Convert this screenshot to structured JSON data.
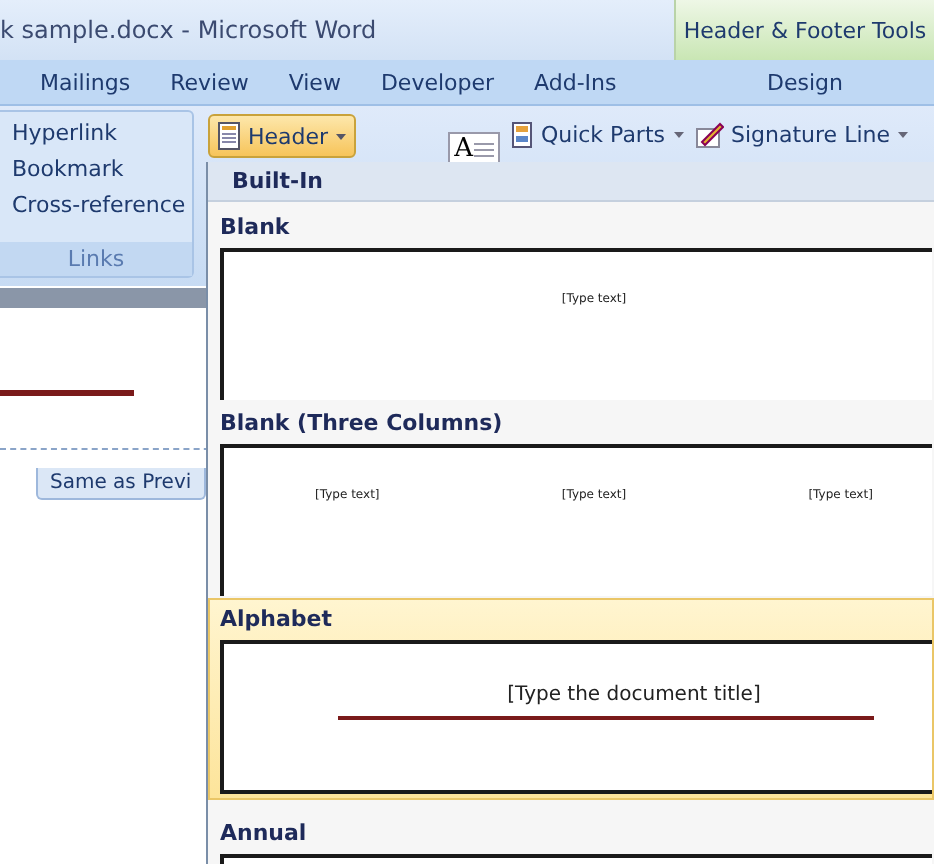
{
  "window": {
    "title": "k sample.docx - Microsoft Word",
    "contextual_title": "Header & Footer Tools"
  },
  "tabs": [
    {
      "label": "Mailings",
      "selected": false
    },
    {
      "label": "Review",
      "selected": false
    },
    {
      "label": "View",
      "selected": false
    },
    {
      "label": "Developer",
      "selected": false
    },
    {
      "label": "Add-Ins",
      "selected": false
    },
    {
      "label": "Design",
      "selected": false
    }
  ],
  "links_group": {
    "items": [
      "Hyperlink",
      "Bookmark",
      "Cross-reference"
    ],
    "label": "Links"
  },
  "insert_group": {
    "header_button": {
      "label": "Header",
      "active": true
    },
    "text_box_glyph": "A",
    "quick_parts": "Quick Parts",
    "signature_line": "Signature Line"
  },
  "document": {
    "link_tag": "Same as Previ"
  },
  "gallery": {
    "section": "Built-In",
    "items": [
      {
        "name": "Blank",
        "kind": "plain",
        "texts": [
          "[Type text]"
        ],
        "selected": false
      },
      {
        "name": "Blank (Three Columns)",
        "kind": "plain",
        "texts": [
          "[Type text]",
          "[Type text]",
          "[Type text]"
        ],
        "selected": false
      },
      {
        "name": "Alphabet",
        "kind": "ruled",
        "texts": [
          "[Type the document title]"
        ],
        "selected": true
      },
      {
        "name": "Annual",
        "kind": "plain",
        "selected": false
      }
    ]
  }
}
